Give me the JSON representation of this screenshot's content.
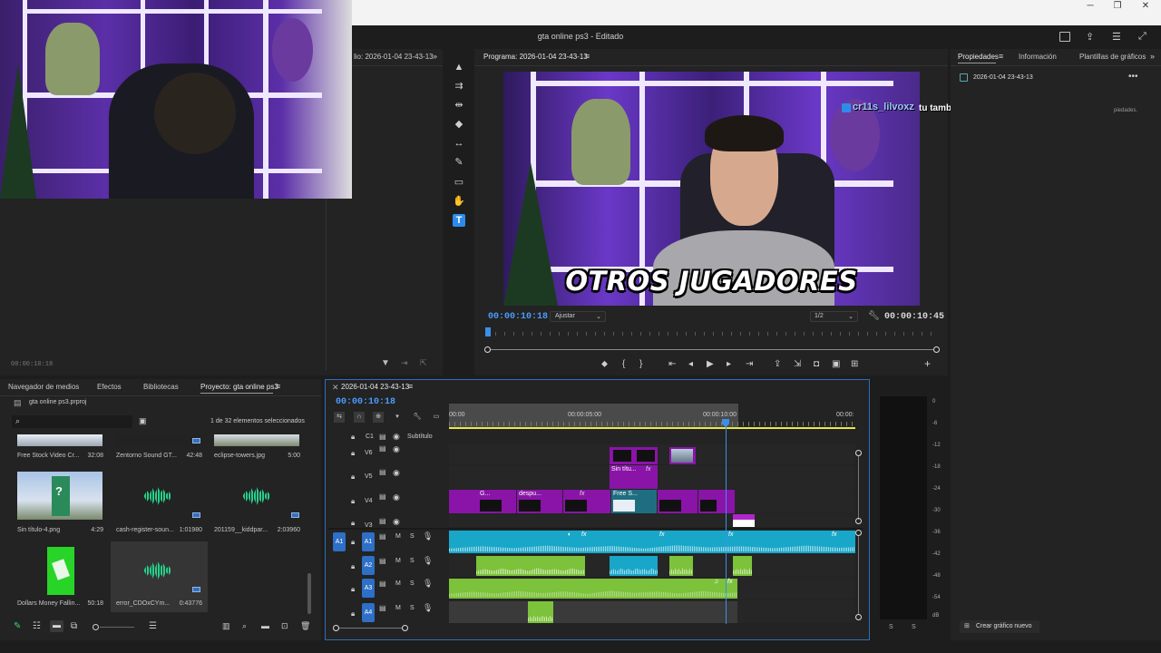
{
  "app": {
    "title": "gta online ps3 - Editado"
  },
  "source_monitor": {
    "title_partial": "lio: 2026-01-04 23-43-13",
    "timecode": "00:00:10:18"
  },
  "program_monitor": {
    "title": "Programa: 2026-01-04 23-43-13",
    "timecode_current": "00:00:10:18",
    "fit_label": "Ajustar",
    "resolution_label": "1/2",
    "timecode_duration": "00:00:10:45",
    "subtitle_text": "OTROS JUGADORES",
    "playhead_fraction": 0.005
  },
  "chat_overlay": {
    "username": "cr11s_lilvoxz",
    "message": "tu también yojana que te haces la clasista"
  },
  "properties_panel": {
    "tabs": [
      "Propiedades",
      "Información",
      "Plantillas de gráficos"
    ],
    "item_name": "2026-01-04 23-43-13",
    "hint_partial": "piedades.",
    "create_button": "Crear gráfico nuevo"
  },
  "project_panel": {
    "tabs": [
      "Navegador de medios",
      "Efectos",
      "Bibliotecas",
      "Proyecto: gta online ps3"
    ],
    "project_file": "gta online ps3.prproj",
    "selection_status": "1 de 32 elementos seleccionados",
    "items": [
      {
        "name": "Free Stock Video Cr...",
        "duration": "32:08"
      },
      {
        "name": "Zentorno Sound GT...",
        "duration": "42:48"
      },
      {
        "name": "eclipse-towers.jpg",
        "duration": "5:00"
      },
      {
        "name": "Sin título-4.png",
        "duration": "4:29"
      },
      {
        "name": "cash-register-soun...",
        "duration": "1:01980"
      },
      {
        "name": "201159__kiddpar...",
        "duration": "2:03960"
      },
      {
        "name": "Dollars Money Fallin...",
        "duration": "50:18"
      },
      {
        "name": "error_CDOxCYm...",
        "duration": "0:43776"
      }
    ]
  },
  "timeline": {
    "sequence_name": "2026-01-04 23-43-13",
    "timecode": "00:00:10:18",
    "ruler_labels": [
      "00:00",
      "00:00:05:00",
      "00:00:10:00",
      "00:00:"
    ],
    "caption_track": {
      "label": "C1",
      "name": "Subtítulo"
    },
    "video_tracks": [
      "V6",
      "V5",
      "V4",
      "V3"
    ],
    "audio_tracks": [
      "A1",
      "A2",
      "A3",
      "A4"
    ],
    "source_patch": "A1",
    "mute_label": "M",
    "solo_label": "S",
    "clip_labels": {
      "sin_titulo": "Sin títu...",
      "g": "G...",
      "despu": "despu...",
      "free_stock": "Free S...",
      "fx": "fx"
    }
  },
  "audio_meter": {
    "scale": [
      "0",
      "-6",
      "-12",
      "-18",
      "-24",
      "-30",
      "-36",
      "-42",
      "-48",
      "-54",
      "dB"
    ],
    "solo_labels": [
      "S",
      "S"
    ]
  },
  "colors": {
    "accent_blue": "#2d8ceb",
    "video_clip": "#8a14a8",
    "audio_clip": "#19a7c9",
    "audio_clip_green": "#7cc23a",
    "playhead": "#3d8ee8",
    "work_area": "#e8e84a"
  }
}
